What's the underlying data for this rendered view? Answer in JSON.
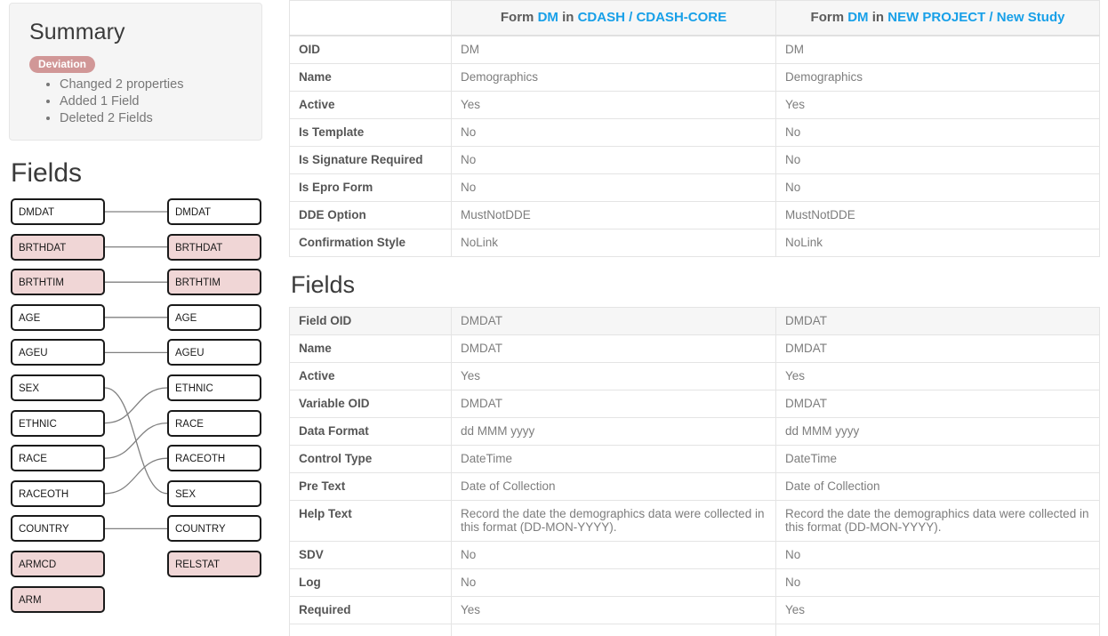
{
  "summary": {
    "title": "Summary",
    "badge": "Deviation",
    "items": [
      "Changed 2 properties",
      "Added 1 Field",
      "Deleted 2 Fields"
    ]
  },
  "fields_section": {
    "heading": "Fields",
    "left_boxes": [
      {
        "label": "DMDAT",
        "changed": false
      },
      {
        "label": "BRTHDAT",
        "changed": true
      },
      {
        "label": "BRTHTIM",
        "changed": true
      },
      {
        "label": "AGE",
        "changed": false
      },
      {
        "label": "AGEU",
        "changed": false
      },
      {
        "label": "SEX",
        "changed": false
      },
      {
        "label": "ETHNIC",
        "changed": false
      },
      {
        "label": "RACE",
        "changed": false
      },
      {
        "label": "RACEOTH",
        "changed": false
      },
      {
        "label": "COUNTRY",
        "changed": false
      },
      {
        "label": "ARMCD",
        "changed": true
      },
      {
        "label": "ARM",
        "changed": true
      }
    ],
    "right_boxes": [
      {
        "label": "DMDAT",
        "changed": false
      },
      {
        "label": "BRTHDAT",
        "changed": true
      },
      {
        "label": "BRTHTIM",
        "changed": true
      },
      {
        "label": "AGE",
        "changed": false
      },
      {
        "label": "AGEU",
        "changed": false
      },
      {
        "label": "ETHNIC",
        "changed": false
      },
      {
        "label": "RACE",
        "changed": false
      },
      {
        "label": "RACEOTH",
        "changed": false
      },
      {
        "label": "SEX",
        "changed": false
      },
      {
        "label": "COUNTRY",
        "changed": false
      },
      {
        "label": "RELSTAT",
        "changed": true
      }
    ],
    "links": [
      {
        "from": 0,
        "to": 0
      },
      {
        "from": 1,
        "to": 1
      },
      {
        "from": 2,
        "to": 2
      },
      {
        "from": 3,
        "to": 3
      },
      {
        "from": 4,
        "to": 4
      },
      {
        "from": 5,
        "to": 8
      },
      {
        "from": 6,
        "to": 5
      },
      {
        "from": 7,
        "to": 6
      },
      {
        "from": 8,
        "to": 7
      },
      {
        "from": 9,
        "to": 9
      }
    ]
  },
  "form_table": {
    "header": {
      "blank": "",
      "left": {
        "prefix": "Form",
        "form": "DM",
        "in": "in",
        "project": "CDASH",
        "sep": "/",
        "study": "CDASH-CORE"
      },
      "right": {
        "prefix": "Form",
        "form": "DM",
        "in": "in",
        "project": "NEW PROJECT",
        "sep": "/",
        "study": "New Study"
      }
    },
    "rows": [
      {
        "label": "OID",
        "left": "DM",
        "right": "DM",
        "shaded": false
      },
      {
        "label": "Name",
        "left": "Demographics",
        "right": "Demographics",
        "shaded": false
      },
      {
        "label": "Active",
        "left": "Yes",
        "right": "Yes",
        "shaded": false
      },
      {
        "label": "Is Template",
        "left": "No",
        "right": "No",
        "shaded": false
      },
      {
        "label": "Is Signature Required",
        "left": "No",
        "right": "No",
        "shaded": false
      },
      {
        "label": "Is Epro Form",
        "left": "No",
        "right": "No",
        "shaded": false
      },
      {
        "label": "DDE Option",
        "left": "MustNotDDE",
        "right": "MustNotDDE",
        "shaded": false
      },
      {
        "label": "Confirmation Style",
        "left": "NoLink",
        "right": "NoLink",
        "shaded": false
      }
    ]
  },
  "fields_table": {
    "heading": "Fields",
    "rows": [
      {
        "label": "Field OID",
        "left": "DMDAT",
        "right": "DMDAT",
        "shaded": true
      },
      {
        "label": "Name",
        "left": "DMDAT",
        "right": "DMDAT",
        "shaded": false
      },
      {
        "label": "Active",
        "left": "Yes",
        "right": "Yes",
        "shaded": false
      },
      {
        "label": "Variable OID",
        "left": "DMDAT",
        "right": "DMDAT",
        "shaded": false
      },
      {
        "label": "Data Format",
        "left": "dd MMM yyyy",
        "right": "dd MMM yyyy",
        "shaded": false
      },
      {
        "label": "Control Type",
        "left": "DateTime",
        "right": "DateTime",
        "shaded": false
      },
      {
        "label": "Pre Text",
        "left": "Date of Collection",
        "right": "Date of Collection",
        "shaded": false
      },
      {
        "label": "Help Text",
        "left": "Record the date the demographics data were collected in this format (DD-MON-YYYY).",
        "right": "Record the date the demographics data were collected in this format (DD-MON-YYYY).",
        "shaded": false
      },
      {
        "label": "SDV",
        "left": "No",
        "right": "No",
        "shaded": false
      },
      {
        "label": "Log",
        "left": "No",
        "right": "No",
        "shaded": false
      },
      {
        "label": "Required",
        "left": "Yes",
        "right": "Yes",
        "shaded": false
      },
      {
        "label": "",
        "left": "",
        "right": "",
        "shaded": false
      }
    ]
  },
  "colors": {
    "link": "#18a0e8",
    "badge": "#d19797",
    "changed_box": "#f0d6d6",
    "row_shade": "#f6f6f6"
  }
}
